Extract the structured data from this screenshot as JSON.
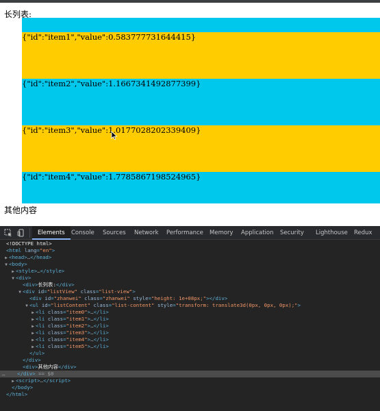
{
  "page": {
    "list_title": "长列表:",
    "items": [
      {
        "text": "{\"id\":\"item1\",\"value\":0.583777731644415}"
      },
      {
        "text": "{\"id\":\"item2\",\"value\":1.1667341492877399}"
      },
      {
        "text": "{\"id\":\"item3\",\"value\":1.0177028202339409}"
      },
      {
        "text": "{\"id\":\"item4\",\"value\":1.7785867198524965}"
      }
    ],
    "other_content": "其他内容",
    "colors": {
      "blue_band": "#00c8ec",
      "yellow_band": "#ffcc00"
    }
  },
  "devtools": {
    "tabs": [
      "Elements",
      "Console",
      "Sources",
      "Network",
      "Performance",
      "Memory",
      "Application",
      "Security",
      "Lighthouse",
      "Redux"
    ],
    "active_tab": "Elements",
    "icons": [
      "inspect-element-icon",
      "device-toolbar-icon"
    ],
    "selected_suffix": "== $0",
    "dom": {
      "doctype": "<!DOCTYPE html>",
      "html_open": "html",
      "lang_attr": "lang",
      "lang_val": "\"en\"",
      "head": "head",
      "body": "body",
      "style": "style",
      "div": "div",
      "title_text": "长列表:",
      "listview_id": "\"listView\"",
      "listview_class": "\"list-view\"",
      "zhanwei_id": "\"zhanwei\"",
      "zhanwei_class": "\"zhanwei\"",
      "zhanwei_style": "\"height: 1e+08px;\"",
      "ul_id": "\"listContent\"",
      "ul_class": "\"list-content\"",
      "ul_style": "\"transform: translate3d(0px, 0px, 0px);\"",
      "li_classes": [
        "\"item0\"",
        "\"item1\"",
        "\"item2\"",
        "\"item3\"",
        "\"item4\"",
        "\"item5\""
      ],
      "other_text": "其他内容",
      "script": "script",
      "ellipsis": "…"
    }
  }
}
